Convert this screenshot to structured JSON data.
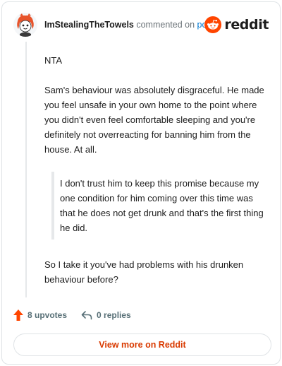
{
  "header": {
    "username": "ImStealingTheTowels",
    "action_text": "commented on",
    "post_link": "post",
    "brand": "reddit"
  },
  "comment": {
    "paragraphs": [
      "NTA",
      "Sam's behaviour was absolutely disgraceful. He made you feel unsafe in your own home to the point where you didn't even feel comfortable sleeping and you're definitely not overreacting for banning him from the house. At all."
    ],
    "quote": "I don't trust him to keep this promise because my one condition for him coming over this time was that he does not get drunk and that's the first thing he did.",
    "closing": "So I take it you've had problems with his drunken behaviour before?"
  },
  "footer": {
    "upvotes": "8 upvotes",
    "replies": "0 replies"
  },
  "cta": {
    "label": "View more on Reddit"
  },
  "colors": {
    "reddit_orange": "#ff4500",
    "link_blue": "#0079d3",
    "cta_text": "#d93a00"
  }
}
